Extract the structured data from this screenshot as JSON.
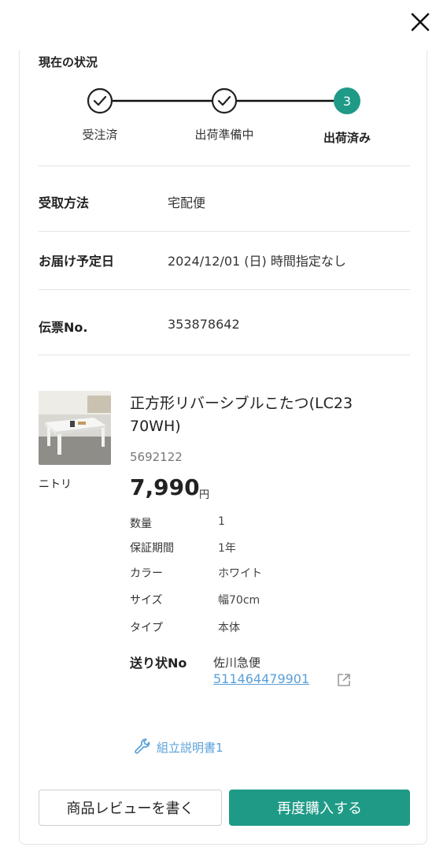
{
  "status": {
    "title": "現在の状況",
    "steps": [
      {
        "label": "受注済",
        "state": "done"
      },
      {
        "label": "出荷準備中",
        "state": "done"
      },
      {
        "label": "出荷済み",
        "state": "current",
        "number": "3"
      }
    ]
  },
  "info": {
    "delivery_method": {
      "label": "受取方法",
      "value": "宅配便"
    },
    "scheduled_date": {
      "label": "お届け予定日",
      "value": "2024/12/01 (日) 時間指定なし"
    },
    "slip": {
      "label": "伝票No.",
      "value": "353878642"
    }
  },
  "product": {
    "brand": "ニトリ",
    "name": "正方形リバーシブルこたつ(LC2370WH)",
    "name_line1": "正方形リバーシブルこたつ(LC23",
    "name_line2": "70WH)",
    "code": "5692122",
    "price": "7,990",
    "currency": "円",
    "attributes": [
      {
        "label": "数量",
        "value": "1"
      },
      {
        "label": "保証期間",
        "value": "1年"
      },
      {
        "label": "カラー",
        "value": "ホワイト"
      },
      {
        "label": "サイズ",
        "value": "幅70cm"
      },
      {
        "label": "タイプ",
        "value": "本体"
      }
    ]
  },
  "tracking": {
    "label": "送り状No",
    "carrier": "佐川急便",
    "number": "511464479901"
  },
  "manual": {
    "label": "組立説明書1"
  },
  "actions": {
    "review_label": "商品レビューを書く",
    "rebuy_label": "再度購入する"
  },
  "colors": {
    "accent": "#1f9a86",
    "link": "#5aa0d8",
    "divider": "#e3e3e3"
  },
  "icons": [
    "close-icon",
    "check-icon",
    "external-link-icon",
    "wrench-icon"
  ]
}
